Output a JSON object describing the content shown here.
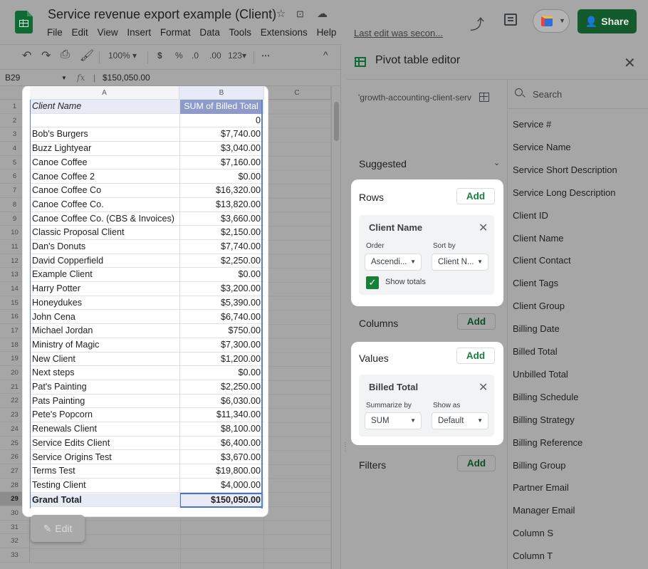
{
  "app": {
    "doc_title": "Service revenue export example (Client)",
    "menu": [
      "File",
      "Edit",
      "View",
      "Insert",
      "Format",
      "Data",
      "Tools",
      "Extensions",
      "Help"
    ],
    "last_edit": "Last edit was secon...",
    "share_label": "Share"
  },
  "toolbar": {
    "zoom": "100%",
    "currency": "$",
    "percent": "%",
    "dec_decrease": ".0",
    "dec_increase": ".00",
    "format_more": "123",
    "more": "⋯"
  },
  "formula_bar": {
    "cell_ref": "B29",
    "fx": "fx",
    "value": "$150,050.00"
  },
  "grid": {
    "columns": [
      "A",
      "B",
      "C"
    ],
    "row_numbers": [
      "1",
      "2",
      "3",
      "4",
      "5",
      "6",
      "7",
      "8",
      "9",
      "10",
      "11",
      "12",
      "13",
      "14",
      "15",
      "16",
      "17",
      "18",
      "19",
      "20",
      "21",
      "22",
      "23",
      "24",
      "25",
      "26",
      "27",
      "28",
      "29",
      "30",
      "31",
      "32",
      "33"
    ],
    "header": {
      "a": "Client Name",
      "b": "SUM of Billed Total"
    },
    "rows": [
      {
        "a": "",
        "b": "0"
      },
      {
        "a": "Bob's Burgers",
        "b": "$7,740.00"
      },
      {
        "a": "Buzz Lightyear",
        "b": "$3,040.00"
      },
      {
        "a": "Canoe Coffee",
        "b": "$7,160.00"
      },
      {
        "a": "Canoe Coffee 2",
        "b": "$0.00"
      },
      {
        "a": "Canoe Coffee Co",
        "b": "$16,320.00"
      },
      {
        "a": "Canoe Coffee Co.",
        "b": "$13,820.00"
      },
      {
        "a": "Canoe Coffee Co. (CBS & Invoices)",
        "b": "$3,660.00"
      },
      {
        "a": "Classic Proposal Client",
        "b": "$2,150.00"
      },
      {
        "a": "Dan's Donuts",
        "b": "$7,740.00"
      },
      {
        "a": "David Copperfield",
        "b": "$2,250.00"
      },
      {
        "a": "Example Client",
        "b": "$0.00"
      },
      {
        "a": "Harry Potter",
        "b": "$3,200.00"
      },
      {
        "a": "Honeydukes",
        "b": "$5,390.00"
      },
      {
        "a": "John Cena",
        "b": "$6,740.00"
      },
      {
        "a": "Michael Jordan",
        "b": "$750.00"
      },
      {
        "a": "Ministry of Magic",
        "b": "$7,300.00"
      },
      {
        "a": "New Client",
        "b": "$1,200.00"
      },
      {
        "a": "Next steps",
        "b": "$0.00"
      },
      {
        "a": "Pat's Painting",
        "b": "$2,250.00"
      },
      {
        "a": "Pats Painting",
        "b": "$6,030.00"
      },
      {
        "a": "Pete's Popcorn",
        "b": "$11,340.00"
      },
      {
        "a": "Renewals Client",
        "b": "$8,100.00"
      },
      {
        "a": "Service Edits Client",
        "b": "$6,400.00"
      },
      {
        "a": "Service Origins Test",
        "b": "$3,670.00"
      },
      {
        "a": "Terms Test",
        "b": "$19,800.00"
      },
      {
        "a": "Testing Client",
        "b": "$4,000.00"
      }
    ],
    "total": {
      "a": "Grand Total",
      "b": "$150,050.00"
    },
    "edit_label": "Edit"
  },
  "pivot_editor": {
    "title": "Pivot table editor",
    "range": "'growth-accounting-client-serv",
    "suggested": "Suggested",
    "rows_label": "Rows",
    "columns_label": "Columns",
    "values_label": "Values",
    "filters_label": "Filters",
    "add_label": "Add",
    "row_field": {
      "name": "Client Name",
      "order_label": "Order",
      "order_value": "Ascendi...",
      "sort_label": "Sort by",
      "sort_value": "Client N...",
      "totals_label": "Show totals"
    },
    "value_field": {
      "name": "Billed Total",
      "summarize_label": "Summarize by",
      "summarize_value": "SUM",
      "show_as_label": "Show as",
      "show_as_value": "Default"
    },
    "search_placeholder": "Search",
    "fields": [
      "Service #",
      "Service Name",
      "Service Short Description",
      "Service Long Description",
      "Client ID",
      "Client Name",
      "Client Contact",
      "Client Tags",
      "Client Group",
      "Billing Date",
      "Billed Total",
      "Unbilled Total",
      "Billing Schedule",
      "Billing Strategy",
      "Billing Reference",
      "Billing Group",
      "Partner Email",
      "Manager Email",
      "Column S",
      "Column T"
    ]
  },
  "colors": {
    "brand_green": "#188038",
    "share_bg": "#135a2d",
    "pivot_header": "#8e9bc8",
    "selection": "#4b72c2"
  }
}
